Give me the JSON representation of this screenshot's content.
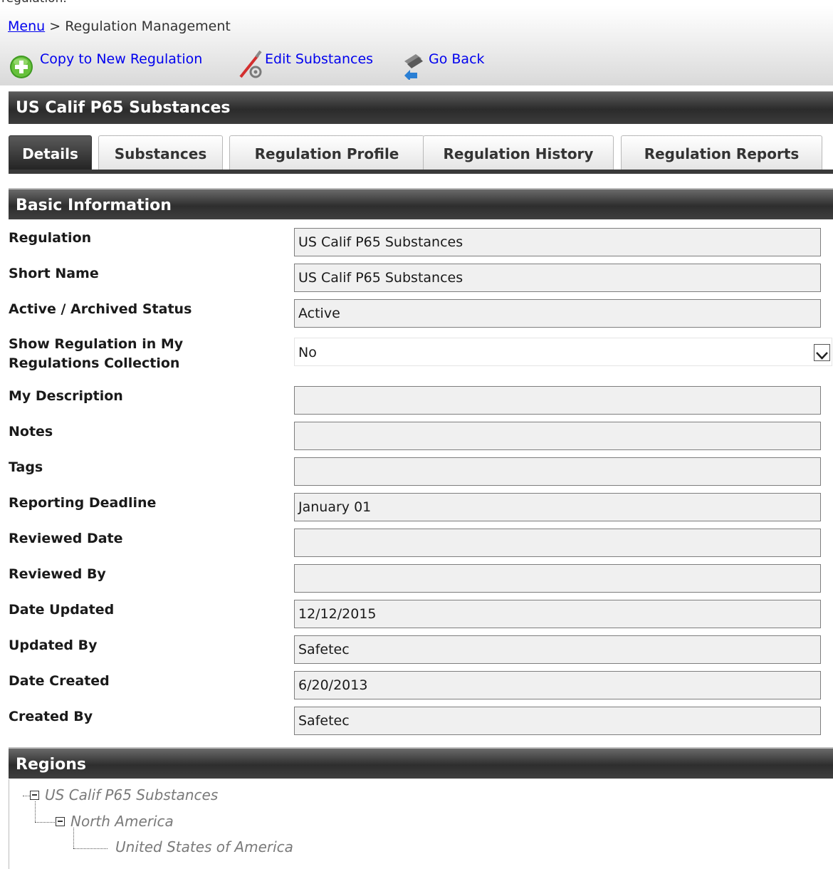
{
  "header": {
    "cropped_text": "regulation.",
    "breadcrumb": {
      "link": "Menu",
      "separator": ">",
      "current": "Regulation Management"
    },
    "toolbar": {
      "copy_label": "Copy to New Regulation",
      "edit_label": "Edit Substances",
      "back_label": "Go Back"
    }
  },
  "page_title": "US Calif P65 Substances",
  "tabs": [
    "Details",
    "Substances",
    "Regulation Profile",
    "Regulation History",
    "Regulation Reports"
  ],
  "active_tab": "Details",
  "basic_info": {
    "title": "Basic Information",
    "fields": [
      {
        "label": "Regulation",
        "value": "US Calif P65 Substances"
      },
      {
        "label": "Short Name",
        "value": "US Calif P65 Substances"
      },
      {
        "label": "Active / Archived Status",
        "value": "Active"
      },
      {
        "label_line1": "Show Regulation in My",
        "label_line2": "Regulations Collection",
        "value": "No"
      },
      {
        "label": "My Description",
        "value": ""
      },
      {
        "label": "Notes",
        "value": ""
      },
      {
        "label": "Tags",
        "value": ""
      },
      {
        "label": "Reporting Deadline",
        "value": "January 01"
      },
      {
        "label": "Reviewed Date",
        "value": ""
      },
      {
        "label": "Reviewed By",
        "value": ""
      },
      {
        "label": "Date Updated",
        "value": "12/12/2015"
      },
      {
        "label": "Updated By",
        "value": "Safetec"
      },
      {
        "label": "Date Created",
        "value": "6/20/2013"
      },
      {
        "label": "Created By",
        "value": "Safetec"
      }
    ]
  },
  "regions": {
    "title": "Regions",
    "tree": [
      "US Calif P65 Substances",
      "North America",
      "United States of America"
    ]
  },
  "colors": {
    "link": "#0000ee",
    "header_bar": "#2b2b2b",
    "field_bg": "#f0f0f0",
    "tree_text": "#7a7a7a"
  },
  "icons": [
    "add-circle-icon",
    "edit-tools-icon",
    "go-back-icon",
    "chevron-down-icon",
    "collapse-icon"
  ]
}
